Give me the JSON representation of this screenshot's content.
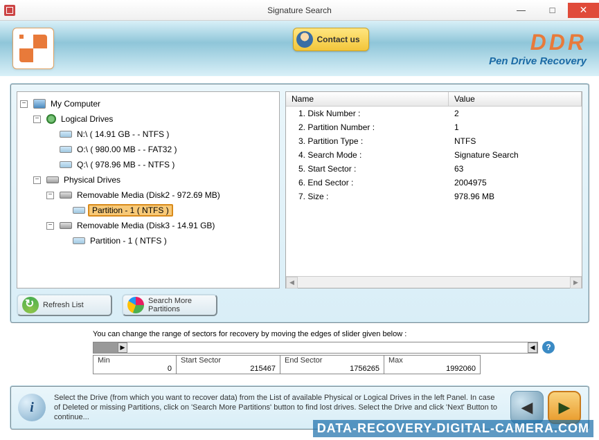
{
  "window": {
    "title": "Signature Search"
  },
  "header": {
    "contact_label": "Contact us",
    "brand": "DDR",
    "subbrand": "Pen Drive Recovery"
  },
  "tree": {
    "root": "My Computer",
    "logical_label": "Logical Drives",
    "logical": [
      "N:\\ ( 14.91 GB -  - NTFS )",
      "O:\\ ( 980.00 MB -  - FAT32 )",
      "Q:\\ ( 978.96 MB -  - NTFS )"
    ],
    "physical_label": "Physical Drives",
    "physical": [
      {
        "label": "Removable Media (Disk2 - 972.69 MB)",
        "partitions": [
          "Partition - 1 ( NTFS )"
        ]
      },
      {
        "label": "Removable Media (Disk3 - 14.91 GB)",
        "partitions": [
          "Partition - 1 ( NTFS )"
        ]
      }
    ],
    "selected": "Partition - 1 ( NTFS )"
  },
  "details": {
    "columns": {
      "name": "Name",
      "value": "Value"
    },
    "rows": [
      {
        "name": "1. Disk Number :",
        "value": "2"
      },
      {
        "name": "2. Partition Number :",
        "value": "1"
      },
      {
        "name": "3. Partition Type :",
        "value": "NTFS"
      },
      {
        "name": "4. Search Mode :",
        "value": "Signature Search"
      },
      {
        "name": "5. Start Sector :",
        "value": "63"
      },
      {
        "name": "6. End Sector :",
        "value": "2004975"
      },
      {
        "name": "7. Size :",
        "value": "978.96 MB"
      }
    ]
  },
  "buttons": {
    "refresh": "Refresh List",
    "search_more": "Search More\nPartitions"
  },
  "sectors": {
    "intro": "You can change the range of sectors for recovery by moving the edges of slider given below :",
    "min_label": "Min",
    "min_value": "0",
    "start_label": "Start Sector",
    "start_value": "215467",
    "end_label": "End Sector",
    "end_value": "1756265",
    "max_label": "Max",
    "max_value": "1992060"
  },
  "footer": {
    "text": "Select the Drive (from which you want to recover data) from the List of available Physical or Logical Drives in the left Panel. In case of Deleted or missing Partitions, click on 'Search More Partitions' button to find lost drives. Select the Drive and click 'Next' Button to continue..."
  },
  "watermark": "DATA-RECOVERY-DIGITAL-CAMERA.COM"
}
